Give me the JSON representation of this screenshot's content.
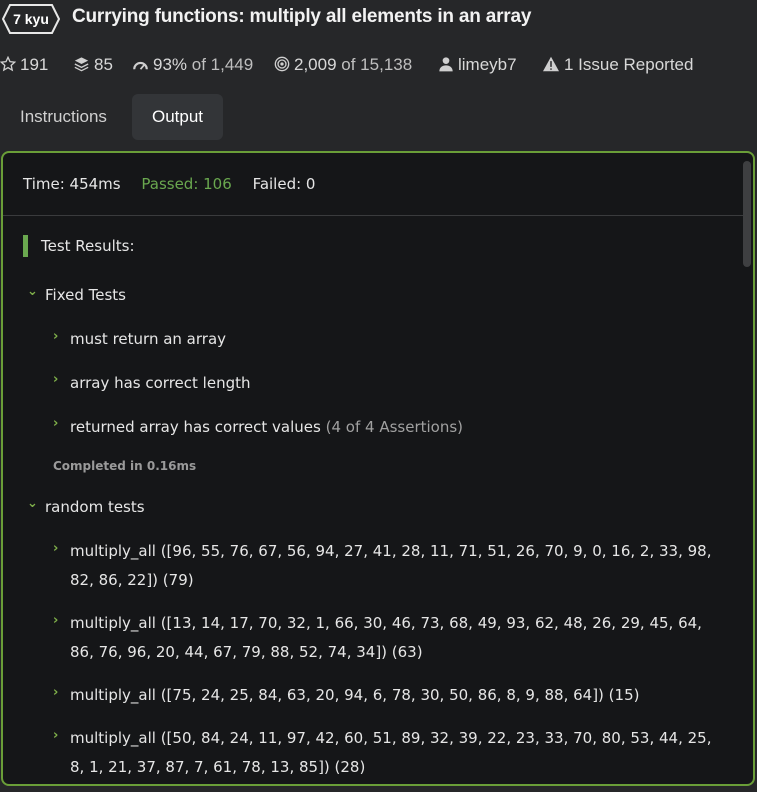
{
  "kata": {
    "kyu": "7 kyu",
    "title": "Currying functions: multiply all elements in an array"
  },
  "stats": {
    "stars": "191",
    "collections": "85",
    "satisfaction": "93%",
    "satisfaction_of": "of 1,449",
    "completed": "2,009",
    "completed_of": "of 15,138",
    "author": "limeyb7",
    "issues": "1 Issue Reported"
  },
  "tabs": [
    "Instructions",
    "Output"
  ],
  "output": {
    "time": "Time: 454ms",
    "passed": "Passed: 106",
    "failed": "Failed: 0",
    "results_title": "Test Results:",
    "fixed_group": "Fixed Tests",
    "fixed_items": [
      {
        "label": "must return an array"
      },
      {
        "label": "array has correct length"
      },
      {
        "label": "returned array has correct values",
        "assertions": "(4 of 4 Assertions)"
      }
    ],
    "completed": "Completed in 0.16ms",
    "random_group": "random tests",
    "random_items": [
      {
        "line1": "multiply_all ([96, 55, 76, 67, 56, 94, 27, 41, 28, 11, 71, 51, 26, 70, 9, 0, 16, 2, 33, 98,",
        "line2": "82, 86, 22]) (79)"
      },
      {
        "line1": "multiply_all ([13, 14, 17, 70, 32, 1, 66, 30, 46, 73, 68, 49, 93, 62, 48, 26, 29, 45, 64,",
        "line2": "86, 76, 96, 20, 44, 67, 79, 88, 52, 74, 34]) (63)"
      },
      {
        "line1": "multiply_all ([75, 24, 25, 84, 63, 20, 94, 6, 78, 30, 50, 86, 8, 9, 88, 64]) (15)"
      },
      {
        "line1": "multiply_all ([50, 84, 24, 11, 97, 42, 60, 51, 89, 32, 39, 22, 23, 33, 70, 80, 53, 44, 25,",
        "line2": "8, 1, 21, 37, 87, 7, 61, 78, 13, 85]) (28)"
      }
    ]
  },
  "colors": {
    "accent": "#6aa84f",
    "panel_border": "#6a9e38",
    "background": "#262729"
  }
}
